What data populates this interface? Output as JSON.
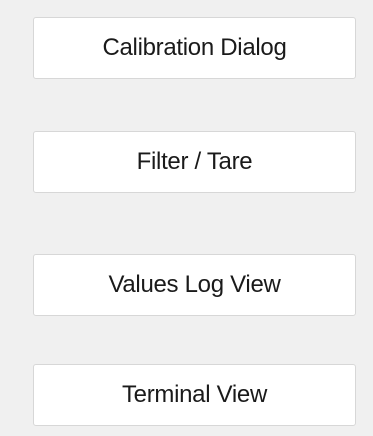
{
  "buttons": {
    "calibration": "Calibration Dialog",
    "filter_tare": "Filter / Tare",
    "values_log": "Values Log View",
    "terminal": "Terminal View"
  }
}
